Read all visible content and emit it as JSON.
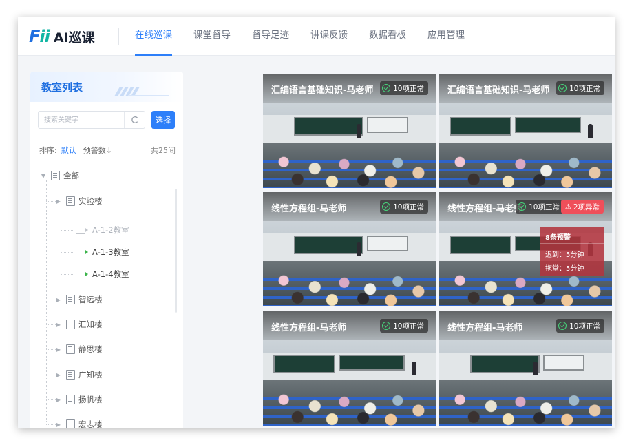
{
  "app": {
    "logo_mark_a": "F",
    "logo_mark_b": "i",
    "logo_mark_c": "i",
    "name": "AI巡课"
  },
  "nav": [
    {
      "label": "在线巡课",
      "active": true
    },
    {
      "label": "课堂督导",
      "active": false
    },
    {
      "label": "督导足迹",
      "active": false
    },
    {
      "label": "讲课反馈",
      "active": false
    },
    {
      "label": "数据看板",
      "active": false
    },
    {
      "label": "应用管理",
      "active": false
    }
  ],
  "sidebar": {
    "title": "教室列表",
    "search_placeholder": "搜索关键字",
    "search_icon": "search-icon",
    "select_button": "选择",
    "sort_label": "排序:",
    "sort_default": "默认",
    "sort_alert": "预警数↓",
    "total": "共25间",
    "tree": {
      "root": "全部",
      "buildings": [
        {
          "name": "实验楼",
          "expanded": true,
          "rooms": [
            {
              "name": "A-1-2教室",
              "online": false
            },
            {
              "name": "A-1-3教室",
              "online": true
            },
            {
              "name": "A-1-4教室",
              "online": true
            }
          ]
        },
        {
          "name": "智远楼"
        },
        {
          "name": "汇知楼"
        },
        {
          "name": "静思楼"
        },
        {
          "name": "广知楼"
        },
        {
          "name": "扬帆楼"
        },
        {
          "name": "宏志楼"
        }
      ]
    }
  },
  "tiles": [
    {
      "title": "汇编语言基础知识-马老师",
      "status": "10项正常"
    },
    {
      "title": "汇编语言基础知识-马老师",
      "status": "10项正常"
    },
    {
      "title": "线性方程组-马老师",
      "status": "10项正常"
    },
    {
      "title": "线性方程组-马老师",
      "status": "10项正常",
      "error": "2项异常",
      "alert": {
        "title": "8条预警",
        "items": [
          "迟到：5分钟",
          "拖堂：5分钟"
        ]
      }
    },
    {
      "title": "线性方程组-马老师",
      "status": "10项正常"
    },
    {
      "title": "线性方程组-马老师",
      "status": "10项正常"
    }
  ],
  "colors": {
    "accent": "#2d7ff9",
    "ok": "#46d37a",
    "error": "#ef4f5a"
  }
}
